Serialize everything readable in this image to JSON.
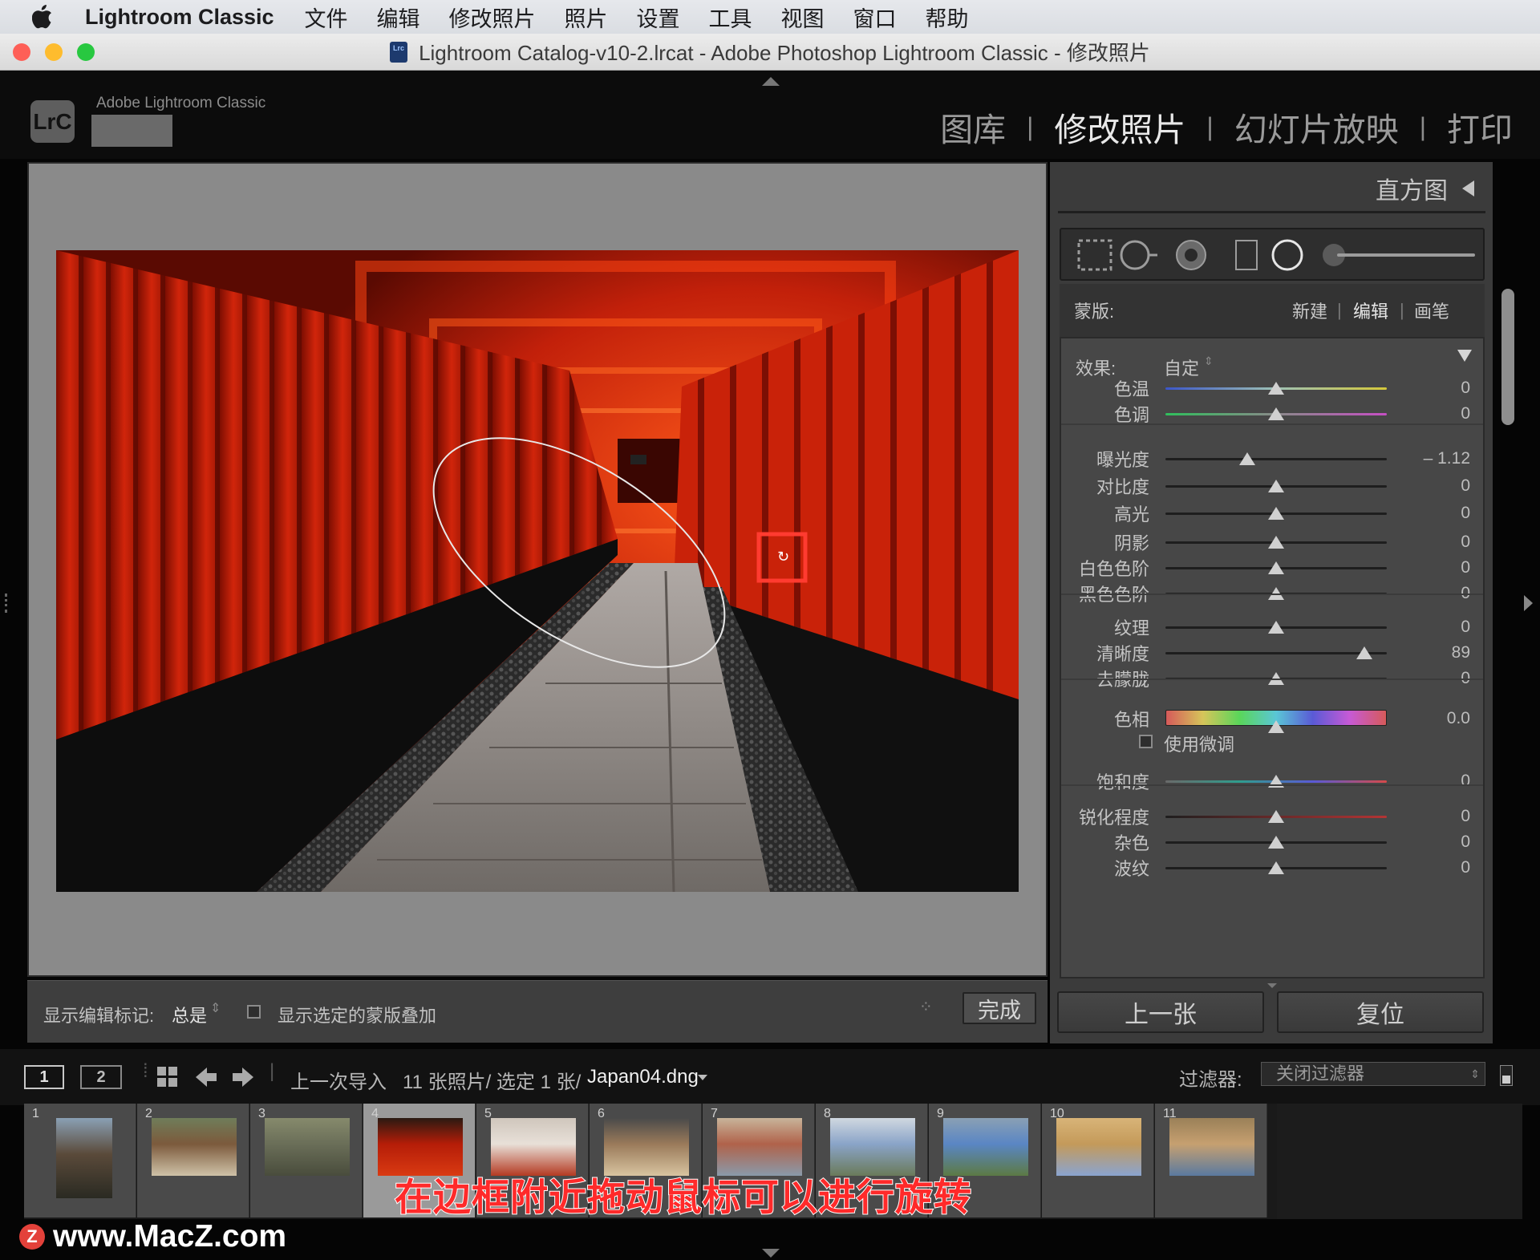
{
  "menubar": {
    "app_name": "Lightroom Classic",
    "items": [
      "文件",
      "编辑",
      "修改照片",
      "照片",
      "设置",
      "工具",
      "视图",
      "窗口",
      "帮助"
    ]
  },
  "window": {
    "title": "Lightroom Catalog-v10-2.lrcat - Adobe Photoshop Lightroom Classic - 修改照片",
    "file_icon_text": "Lrc",
    "traffic_colors": {
      "close": "#fe5f57",
      "minimize": "#febc2e",
      "zoom": "#28c840"
    }
  },
  "header": {
    "logo_text": "LrC",
    "brand": "Adobe Lightroom Classic",
    "modules": [
      "图库",
      "修改照片",
      "幻灯片放映",
      "打印"
    ],
    "active_module": "修改照片"
  },
  "viewer_toolbar": {
    "show_edit_pins_label": "显示编辑标记:",
    "show_edit_pins_value": "总是",
    "show_mask_overlay_label": "显示选定的蒙版叠加",
    "done_button": "完成"
  },
  "panel": {
    "histogram_label": "直方图",
    "mask_label": "蒙版:",
    "mask_new": "新建",
    "mask_edit": "编辑",
    "mask_brush": "画笔",
    "effect_label": "效果:",
    "effect_value": "自定",
    "sliders": [
      {
        "label": "色温",
        "value": "0",
        "pos": 0.5
      },
      {
        "label": "色调",
        "value": "0",
        "pos": 0.5
      },
      {
        "label": "曝光度",
        "value": "– 1.12",
        "pos": 0.37
      },
      {
        "label": "对比度",
        "value": "0",
        "pos": 0.5
      },
      {
        "label": "高光",
        "value": "0",
        "pos": 0.5
      },
      {
        "label": "阴影",
        "value": "0",
        "pos": 0.5
      },
      {
        "label": "白色色阶",
        "value": "0",
        "pos": 0.5
      },
      {
        "label": "黑色色阶",
        "value": "0",
        "pos": 0.5
      },
      {
        "label": "纹理",
        "value": "0",
        "pos": 0.5
      },
      {
        "label": "清晰度",
        "value": "89",
        "pos": 0.9
      },
      {
        "label": "去朦胧",
        "value": "0",
        "pos": 0.5
      },
      {
        "label": "色相",
        "value": "0.0",
        "pos": 0.5
      },
      {
        "label": "饱和度",
        "value": "0",
        "pos": 0.5
      },
      {
        "label": "锐化程度",
        "value": "0",
        "pos": 0.5
      },
      {
        "label": "杂色",
        "value": "0",
        "pos": 0.5
      },
      {
        "label": "波纹",
        "value": "0",
        "pos": 0.5
      }
    ],
    "fine_tune_label": "使用微调",
    "prev_button": "上一张",
    "reset_button": "复位"
  },
  "filmstrip_bar": {
    "view1": "1",
    "view2": "2",
    "source": "上一次导入",
    "count": "11 张照片/ 选定 1 张/",
    "filename": "Japan04.dng",
    "filter_label": "过滤器:",
    "filter_value": "关闭过滤器"
  },
  "filmstrip": {
    "numbers": [
      "1",
      "2",
      "3",
      "4",
      "5",
      "6",
      "7",
      "8",
      "9",
      "10",
      "11"
    ],
    "selected_index": 3
  },
  "caption": "在边框附近拖动鼠标可以进行旋转",
  "watermark": "www.MacZ.com"
}
